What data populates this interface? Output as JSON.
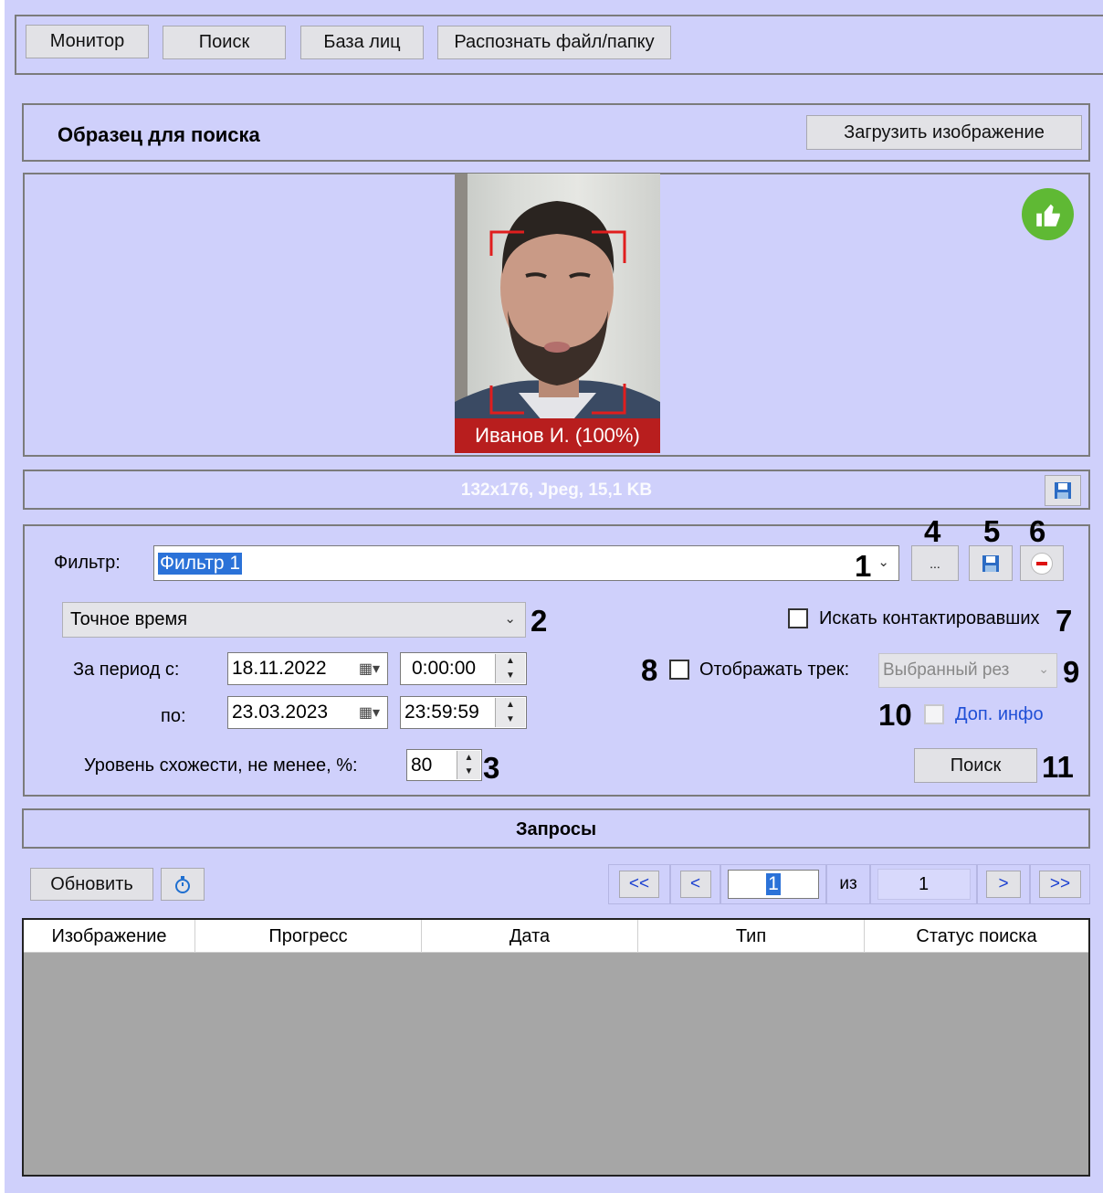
{
  "toolbar": {
    "tabs": [
      {
        "label": "Монитор"
      },
      {
        "label": "Поиск"
      },
      {
        "label": "База лиц"
      },
      {
        "label": "Распознать файл/папку"
      }
    ]
  },
  "sample": {
    "title": "Образец для поиска",
    "upload_label": "Загрузить изображение",
    "face_caption": "Иванов И. (100%)",
    "image_info": "132x176, Jpeg, 15,1 KB",
    "status_icon": "thumbs-up-icon",
    "status_color": "#5fb934"
  },
  "filter": {
    "label": "Фильтр:",
    "value": "Фильтр 1",
    "time_mode": "Точное время",
    "period_from_label": "За период с:",
    "period_to_label": "по:",
    "date_from": "18.11.2022",
    "time_from": "0:00:00",
    "date_to": "23.03.2023",
    "time_to": "23:59:59",
    "similarity_label": "Уровень схожести, не менее, %:",
    "similarity_value": "80",
    "search_contacts_label": "Искать контактировавших",
    "show_track_label": "Отображать трек:",
    "track_mode": "Выбранный рез",
    "extra_info_label": "Доп. инфо",
    "search_button": "Поиск",
    "more_button": "..."
  },
  "callouts": [
    "1",
    "2",
    "3",
    "4",
    "5",
    "6",
    "7",
    "8",
    "9",
    "10",
    "11"
  ],
  "requests": {
    "title": "Запросы",
    "refresh_label": "Обновить",
    "pagination": {
      "first": "<<",
      "prev": "<",
      "current_page": "1",
      "of_label": "из",
      "total_pages": "1",
      "next": ">",
      "last": ">>"
    },
    "columns": [
      "Изображение",
      "Прогресс",
      "Дата",
      "Тип",
      "Статус поиска"
    ]
  }
}
